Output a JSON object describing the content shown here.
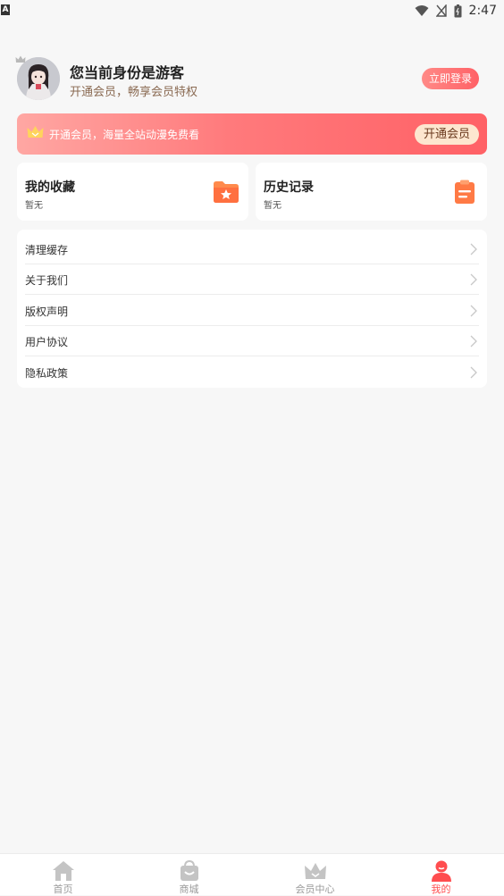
{
  "statusbar": {
    "time": "2:47",
    "left_badge": "A"
  },
  "profile": {
    "title": "您当前身份是游客",
    "subtitle": "开通会员，畅享会员特权",
    "login_button": "立即登录"
  },
  "vip_banner": {
    "text": "开通会员，海量全站动漫免费看",
    "button": "开通会员"
  },
  "cards": {
    "favorites": {
      "title": "我的收藏",
      "sub": "暂无"
    },
    "history": {
      "title": "历史记录",
      "sub": "暂无"
    }
  },
  "menu": {
    "items": [
      {
        "label": "清理缓存"
      },
      {
        "label": "关于我们"
      },
      {
        "label": "版权声明"
      },
      {
        "label": "用户协议"
      },
      {
        "label": "隐私政策"
      }
    ]
  },
  "tabbar": {
    "tabs": [
      {
        "label": "首页"
      },
      {
        "label": "商城"
      },
      {
        "label": "会员中心"
      },
      {
        "label": "我的"
      }
    ],
    "active": "我的"
  },
  "colors": {
    "accent": "#ff6166",
    "orange": "#ff7a45",
    "background": "#f7f7f7"
  }
}
